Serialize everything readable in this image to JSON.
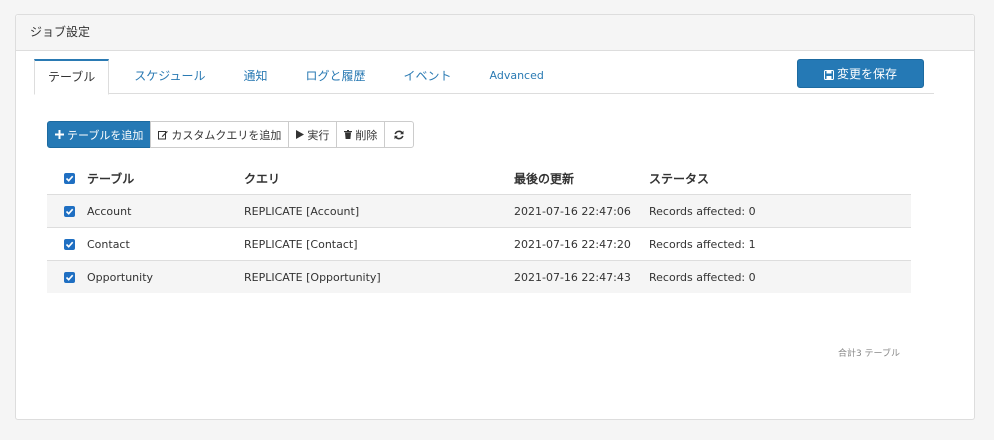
{
  "panel": {
    "title": "ジョブ設定"
  },
  "tabs": [
    {
      "label": "テーブル"
    },
    {
      "label": "スケジュール"
    },
    {
      "label": "通知"
    },
    {
      "label": "ログと履歴"
    },
    {
      "label": "イベント"
    },
    {
      "label": "Advanced"
    }
  ],
  "save_button": {
    "label": "変更を保存",
    "icon": "save-icon"
  },
  "toolbar": {
    "add_table": "テーブルを追加",
    "add_custom_query": "カスタムクエリを追加",
    "run": "実行",
    "delete": "削除"
  },
  "table": {
    "headers": {
      "table": "テーブル",
      "query": "クエリ",
      "last_updated": "最後の更新",
      "status": "ステータス"
    },
    "rows": [
      {
        "table": "Account",
        "query": "REPLICATE [Account]",
        "last_updated": "2021-07-16 22:47:06",
        "status": "Records affected: 0"
      },
      {
        "table": "Contact",
        "query": "REPLICATE [Contact]",
        "last_updated": "2021-07-16 22:47:20",
        "status": "Records affected: 1"
      },
      {
        "table": "Opportunity",
        "query": "REPLICATE [Opportunity]",
        "last_updated": "2021-07-16 22:47:43",
        "status": "Records affected: 0"
      }
    ]
  },
  "footer": {
    "count_text": "合計3 テーブル"
  },
  "colors": {
    "accent": "#2579b5",
    "checkbox": "#1f6fc2"
  }
}
